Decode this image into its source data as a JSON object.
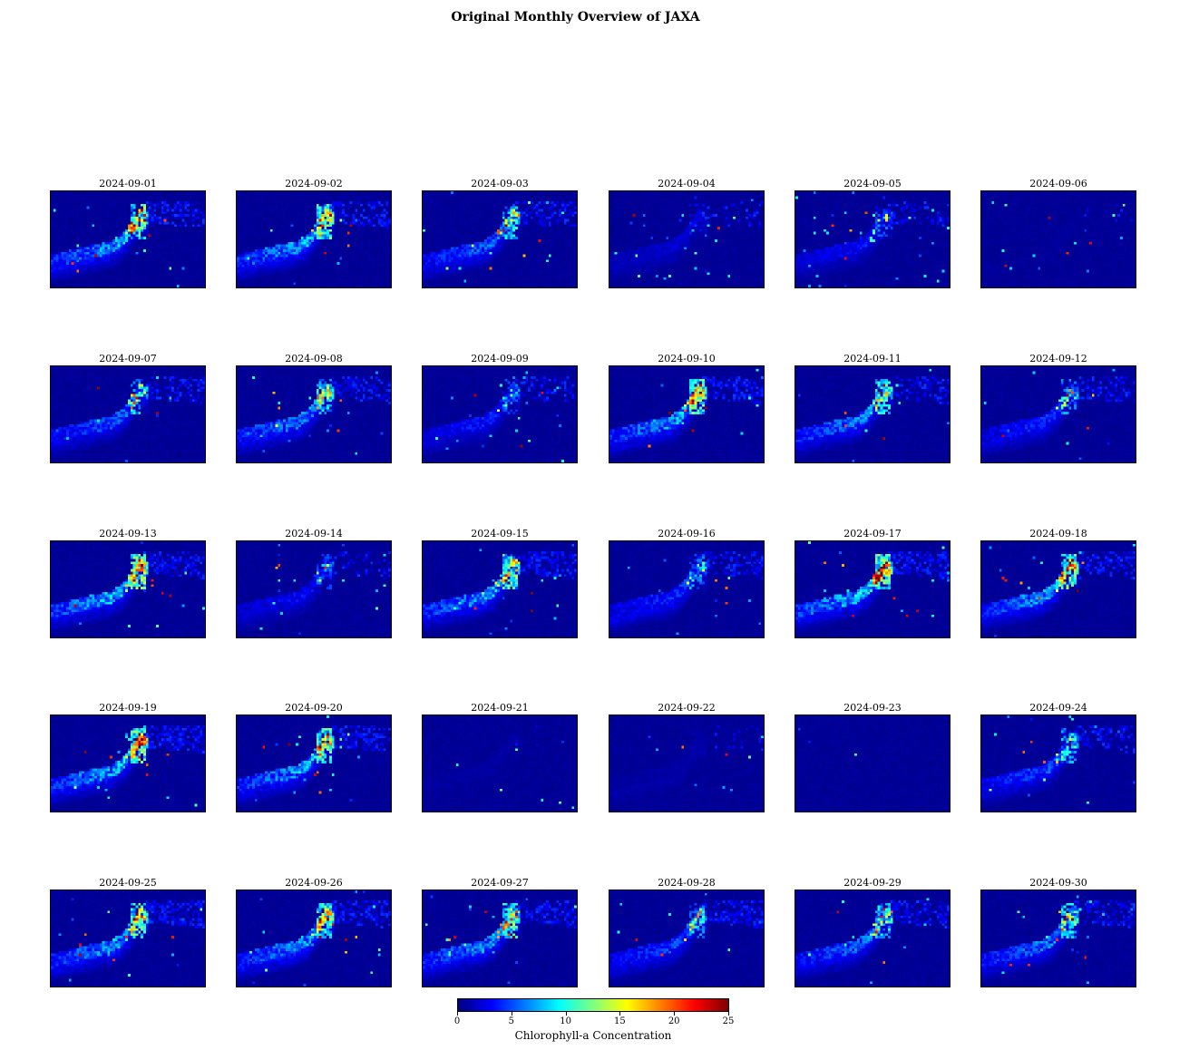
{
  "title": "Original Monthly Overview of JAXA",
  "chart_data": {
    "type": "heatmap",
    "title": "Original Monthly Overview of JAXA",
    "grid": false,
    "layout": {
      "rows": 5,
      "cols": 6
    },
    "colormap": "jet",
    "panels": [
      {
        "date": "2024-09-01",
        "bloom": 0.85,
        "coast": 0.95,
        "scatter": 0.15,
        "hot": 5
      },
      {
        "date": "2024-09-02",
        "bloom": 0.9,
        "coast": 0.95,
        "scatter": 0.15,
        "hot": 5
      },
      {
        "date": "2024-09-03",
        "bloom": 0.65,
        "coast": 0.8,
        "scatter": 0.2,
        "hot": 3
      },
      {
        "date": "2024-09-04",
        "bloom": 0.2,
        "coast": 0.35,
        "scatter": 0.4,
        "hot": 2
      },
      {
        "date": "2024-09-05",
        "bloom": 0.35,
        "coast": 0.5,
        "scatter": 0.6,
        "hot": 4
      },
      {
        "date": "2024-09-06",
        "bloom": 0.0,
        "coast": 0.05,
        "scatter": 0.25,
        "hot": 4
      },
      {
        "date": "2024-09-07",
        "bloom": 0.6,
        "coast": 0.75,
        "scatter": 0.15,
        "hot": 2
      },
      {
        "date": "2024-09-08",
        "bloom": 0.75,
        "coast": 0.9,
        "scatter": 0.25,
        "hot": 4
      },
      {
        "date": "2024-09-09",
        "bloom": 0.4,
        "coast": 0.55,
        "scatter": 0.45,
        "hot": 3
      },
      {
        "date": "2024-09-10",
        "bloom": 0.85,
        "coast": 1.0,
        "scatter": 0.2,
        "hot": 4
      },
      {
        "date": "2024-09-11",
        "bloom": 0.75,
        "coast": 0.85,
        "scatter": 0.15,
        "hot": 3
      },
      {
        "date": "2024-09-12",
        "bloom": 0.45,
        "coast": 0.75,
        "scatter": 0.2,
        "hot": 4
      },
      {
        "date": "2024-09-13",
        "bloom": 0.95,
        "coast": 0.95,
        "scatter": 0.15,
        "hot": 6
      },
      {
        "date": "2024-09-14",
        "bloom": 0.35,
        "coast": 0.5,
        "scatter": 0.3,
        "hot": 2
      },
      {
        "date": "2024-09-15",
        "bloom": 0.85,
        "coast": 0.95,
        "scatter": 0.25,
        "hot": 3
      },
      {
        "date": "2024-09-16",
        "bloom": 0.45,
        "coast": 0.85,
        "scatter": 0.15,
        "hot": 3
      },
      {
        "date": "2024-09-17",
        "bloom": 1.0,
        "coast": 1.0,
        "scatter": 0.2,
        "hot": 7
      },
      {
        "date": "2024-09-18",
        "bloom": 0.85,
        "coast": 0.95,
        "scatter": 0.25,
        "hot": 6
      },
      {
        "date": "2024-09-19",
        "bloom": 0.95,
        "coast": 1.0,
        "scatter": 0.25,
        "hot": 7
      },
      {
        "date": "2024-09-20",
        "bloom": 0.85,
        "coast": 0.95,
        "scatter": 0.25,
        "hot": 5
      },
      {
        "date": "2024-09-21",
        "bloom": 0.05,
        "coast": 0.05,
        "scatter": 0.05,
        "hot": 0
      },
      {
        "date": "2024-09-22",
        "bloom": 0.05,
        "coast": 0.2,
        "scatter": 0.15,
        "hot": 2
      },
      {
        "date": "2024-09-23",
        "bloom": 0.0,
        "coast": 0.0,
        "scatter": 0.02,
        "hot": 0
      },
      {
        "date": "2024-09-24",
        "bloom": 0.55,
        "coast": 0.75,
        "scatter": 0.3,
        "hot": 3
      },
      {
        "date": "2024-09-25",
        "bloom": 0.85,
        "coast": 1.0,
        "scatter": 0.2,
        "hot": 5
      },
      {
        "date": "2024-09-26",
        "bloom": 0.8,
        "coast": 1.0,
        "scatter": 0.2,
        "hot": 5
      },
      {
        "date": "2024-09-27",
        "bloom": 0.8,
        "coast": 1.0,
        "scatter": 0.2,
        "hot": 4
      },
      {
        "date": "2024-09-28",
        "bloom": 0.55,
        "coast": 0.9,
        "scatter": 0.15,
        "hot": 2
      },
      {
        "date": "2024-09-29",
        "bloom": 0.65,
        "coast": 0.85,
        "scatter": 0.15,
        "hot": 3
      },
      {
        "date": "2024-09-30",
        "bloom": 0.7,
        "coast": 0.85,
        "scatter": 0.2,
        "hot": 4
      }
    ],
    "colorbar": {
      "label": "Chlorophyll-a Concentration",
      "min": 0,
      "max": 25,
      "ticks": [
        0,
        5,
        10,
        15,
        20,
        25
      ],
      "orientation": "horizontal"
    }
  }
}
